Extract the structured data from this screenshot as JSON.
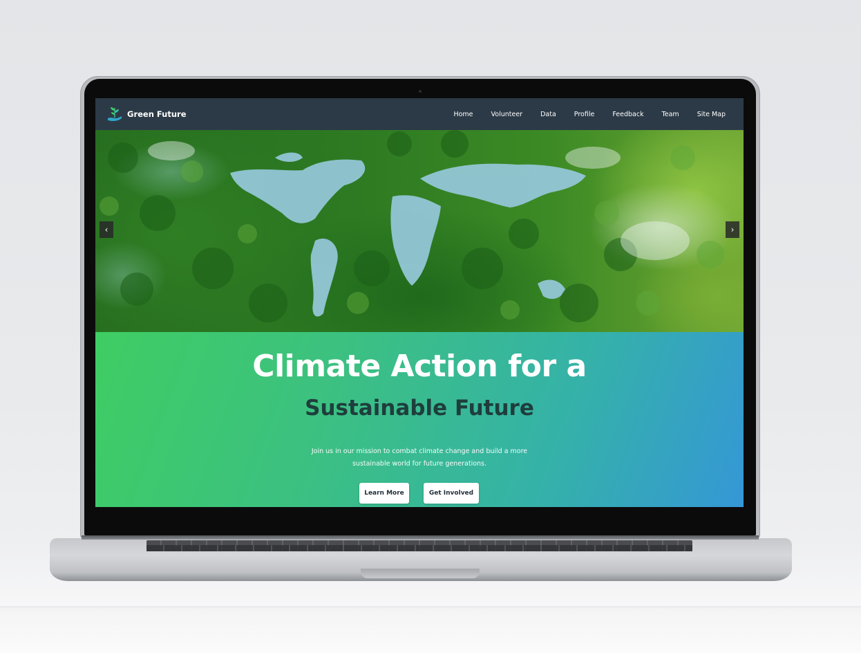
{
  "nav": {
    "brand": "Green Future",
    "logo_icon": "hand-with-sprout-icon",
    "items": [
      "Home",
      "Volunteer",
      "Data",
      "Profile",
      "Feedback",
      "Team",
      "Site Map"
    ]
  },
  "carousel": {
    "prev_label": "‹",
    "next_label": "›"
  },
  "hero": {
    "title_line1": "Climate Action for a",
    "title_line2": "Sustainable Future",
    "subtitle_line1": "Join us in our mission to combat climate change and build a more",
    "subtitle_line2": "sustainable world for future generations.",
    "buttons": {
      "learn_more": "Learn More",
      "get_involved": "Get Involved"
    }
  },
  "colors": {
    "nav_bg": "#2c3a47",
    "hero_gradient_start": "#3fcd63",
    "hero_gradient_end": "#3597d6",
    "heading_dark": "#1e3e3c"
  }
}
